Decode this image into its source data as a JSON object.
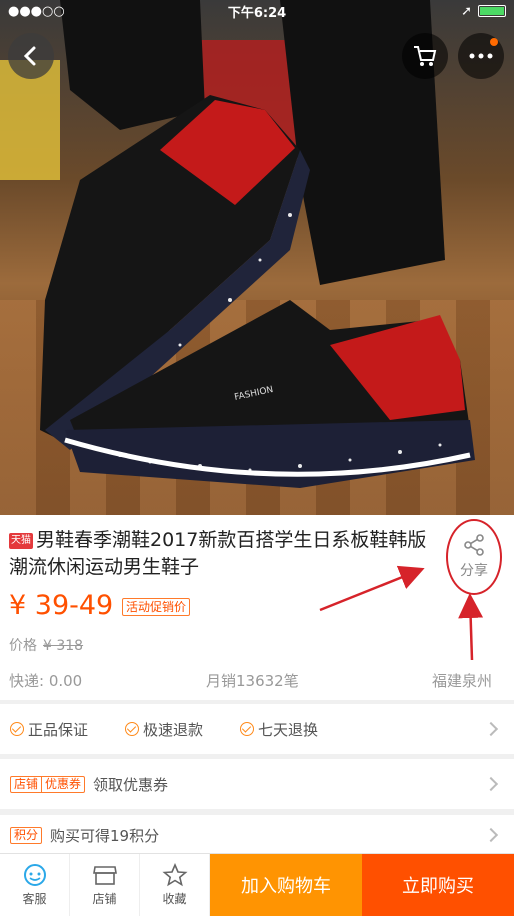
{
  "status_bar": {
    "time": "下午6:24"
  },
  "header": {
    "back_icon": "back-chevron-icon",
    "cart_icon": "cart-icon",
    "more_icon": "more-dots-icon"
  },
  "product": {
    "tmall_tag": "天猫",
    "title": "男鞋春季潮鞋2017新款百搭学生日系板鞋韩版潮流休闲运动男生鞋子",
    "share_label": "分享",
    "price": "¥ 39-49",
    "promo_tag": "活动促销价",
    "original_price_label": "价格",
    "original_price": "¥ 318",
    "shipping": "快递: 0.00",
    "monthly_sales": "月销13632笔",
    "location": "福建泉州"
  },
  "guarantees": [
    {
      "label": "正品保证"
    },
    {
      "label": "极速退款"
    },
    {
      "label": "七天退换"
    }
  ],
  "coupon": {
    "tag_shop": "店铺",
    "tag_coupon": "优惠券",
    "label": "领取优惠券"
  },
  "points": {
    "tag": "积分",
    "label": "购买可得19积分"
  },
  "bottom_bar": {
    "tabs": [
      {
        "label": "客服",
        "icon": "customer-service-icon"
      },
      {
        "label": "店铺",
        "icon": "shop-icon"
      },
      {
        "label": "收藏",
        "icon": "star-icon"
      }
    ],
    "add_to_cart": "加入购物车",
    "buy_now": "立即购买"
  },
  "colors": {
    "accent": "#ff5000",
    "cart_button": "#ff9402",
    "annotation_red": "#d6232a"
  }
}
